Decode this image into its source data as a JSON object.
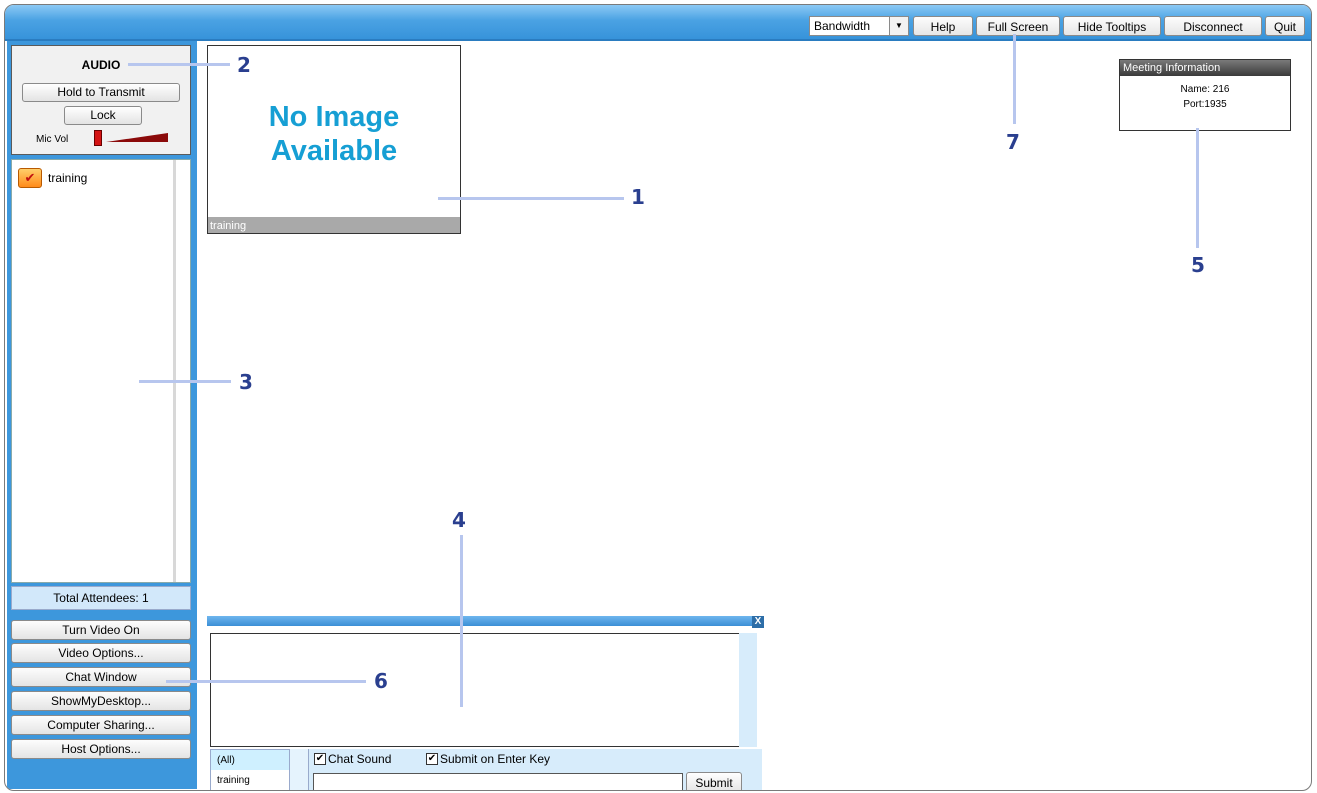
{
  "toolbar": {
    "bandwidth": "Bandwidth",
    "help": "Help",
    "full_screen": "Full Screen",
    "hide_tooltips": "Hide Tooltips",
    "disconnect": "Disconnect",
    "quit": "Quit"
  },
  "audio": {
    "title": "AUDIO",
    "hold_to_transmit": "Hold to Transmit",
    "lock": "Lock",
    "mic_vol_label": "Mic Vol"
  },
  "attendees": {
    "items": [
      {
        "name": "training"
      }
    ],
    "total": "Total Attendees: 1"
  },
  "side_buttons": {
    "turn_video_on": "Turn Video On",
    "video_options": "Video Options...",
    "chat_window": "Chat Window",
    "show_my_desktop": "ShowMyDesktop...",
    "computer_sharing": "Computer Sharing...",
    "host_options": "Host Options..."
  },
  "video": {
    "no_image_line1": "No Image",
    "no_image_line2": "Available",
    "caption": "training"
  },
  "meeting_info": {
    "title": "Meeting Information",
    "name": "Name: 216",
    "port": "Port:1935"
  },
  "chat": {
    "close": "X",
    "recipients": [
      "(All)",
      "training"
    ],
    "chat_sound": "Chat Sound",
    "submit_on_enter": "Submit on Enter Key",
    "submit": "Submit"
  },
  "callouts": [
    "1",
    "2",
    "3",
    "4",
    "5",
    "6",
    "7"
  ],
  "colors": {
    "toolbar_blue": "#3d97dc",
    "no_image_text": "#169fd4",
    "callout_text": "#2a3f8f",
    "callout_line": "#b7c6ee"
  }
}
